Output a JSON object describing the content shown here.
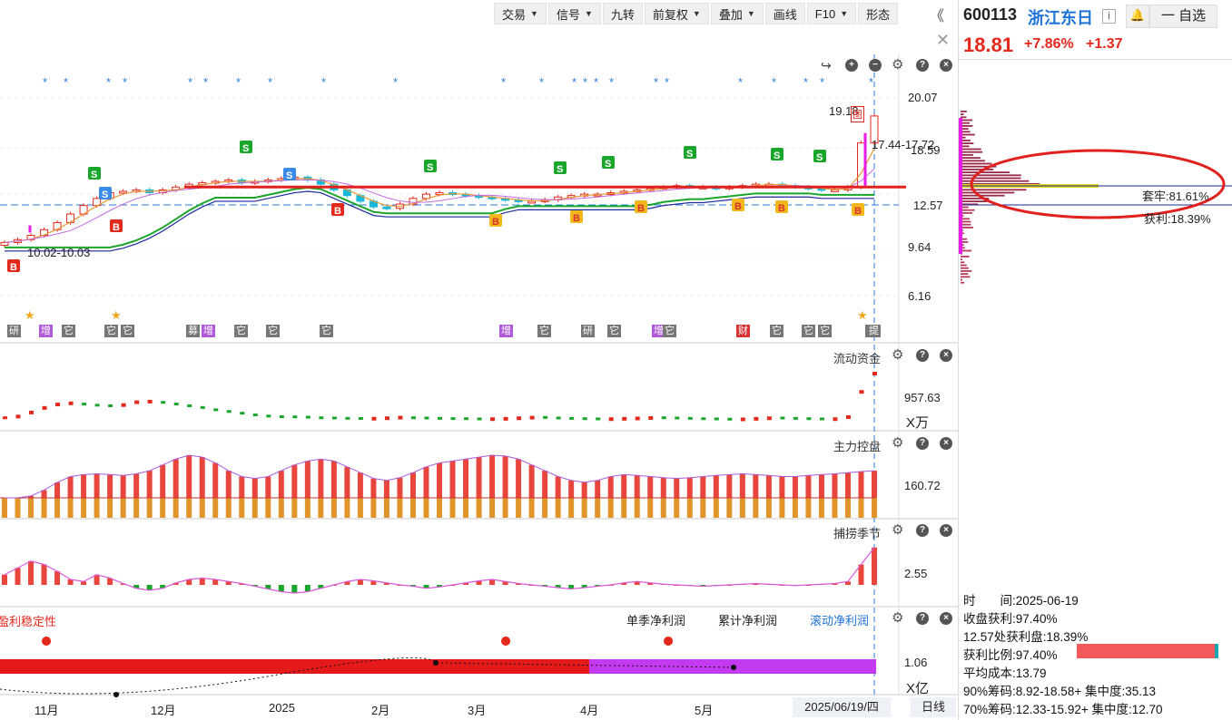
{
  "toolbar": {
    "items": [
      "交易",
      "信号",
      "九转",
      "前复权",
      "叠加",
      "画线",
      "F10",
      "形态"
    ],
    "collapse_icon": "double-chevron-left-icon"
  },
  "quote": {
    "code": "600113",
    "name": "浙江东日",
    "info_icon": "i",
    "watch_label": "一 自选",
    "price": "18.81",
    "change_pct": "+7.86%",
    "change": "+1.37"
  },
  "chip": {
    "trapped": "套牢:81.61%",
    "profit": "获利:18.39%"
  },
  "stats": {
    "time": "时　　间:2025-06-19",
    "close_profit": "收盘获利:97.40%",
    "price_profit": "12.57处获利盘:18.39%",
    "profit_ratio": "获利比例:97.40%",
    "avg_cost": "平均成本:13.79",
    "chip90": "90%筹码:8.92-18.58+ 集中度:35.13",
    "chip70": "70%筹码:12.33-15.92+ 集中度:12.70"
  },
  "main_chart": {
    "y_ticks": [
      "20.07",
      "18.59",
      "12.57",
      "9.64",
      "6.16"
    ],
    "high_label": "19.18",
    "high_marker": "图",
    "range_label": "17.44-17.72",
    "low_label": "10.02-10.03",
    "colors": {
      "up": "#e3281c",
      "down": "#1aa260",
      "highlight": "#e0211d"
    }
  },
  "panels": {
    "flow": {
      "label": "流动资金",
      "value": "957.63",
      "unit": "X万"
    },
    "main_control": {
      "label": "主力控盘",
      "value": "160.72"
    },
    "catch": {
      "label": "捕捞季节",
      "value": "2.55"
    },
    "profit_stability": {
      "label": "盈利稳定性",
      "value": "1.06",
      "unit": "X亿",
      "tabs": [
        "单季净利润",
        "累计净利润",
        "滚动净利润"
      ]
    }
  },
  "x_axis": [
    "11月",
    "12月",
    "2025",
    "2月",
    "3月",
    "4月",
    "5月"
  ],
  "cursor_date": "2025/06/19/四",
  "period": "日线",
  "event_badges": [
    "研",
    "增",
    "它",
    "它",
    "它",
    "募",
    "增",
    "它",
    "它",
    "它",
    "增",
    "它",
    "研",
    "它",
    "增",
    "它",
    "财",
    "它",
    "它",
    "它",
    "它",
    "提"
  ],
  "chart_data": {
    "type": "candlestick",
    "ylim": [
      6.16,
      20.07
    ],
    "y_ticks": [
      20.07,
      18.59,
      12.57,
      9.64,
      6.16
    ],
    "x_categories": [
      "11月",
      "12月",
      "2025",
      "2月",
      "3月",
      "4月",
      "5月"
    ],
    "resistance_level": 13.8,
    "dashed_reference": 12.57,
    "last_price": 18.81,
    "close_series": [
      9.9,
      10.1,
      10.4,
      10.8,
      11.3,
      11.9,
      12.5,
      13.0,
      13.4,
      13.5,
      13.6,
      13.4,
      13.6,
      13.8,
      14.0,
      14.1,
      14.2,
      14.3,
      14.1,
      14.2,
      14.3,
      14.4,
      14.5,
      14.3,
      14.0,
      13.6,
      13.2,
      12.8,
      12.4,
      12.3,
      12.6,
      13.0,
      13.3,
      13.4,
      13.3,
      13.2,
      13.1,
      13.0,
      12.9,
      12.8,
      12.8,
      12.9,
      13.1,
      13.2,
      13.3,
      13.3,
      13.4,
      13.5,
      13.6,
      13.7,
      13.8,
      13.9,
      13.8,
      13.8,
      13.7,
      13.8,
      13.9,
      14.0,
      14.0,
      13.9,
      13.8,
      13.7,
      13.6,
      13.6,
      13.8,
      16.9,
      18.8
    ],
    "flow_series": [
      30,
      45,
      80,
      120,
      150,
      160,
      150,
      140,
      135,
      145,
      170,
      175,
      165,
      150,
      135,
      120,
      100,
      85,
      70,
      55,
      45,
      40,
      38,
      35,
      30,
      28,
      25,
      24,
      26,
      30,
      35,
      30,
      28,
      25,
      23,
      22,
      20,
      22,
      25,
      30,
      35,
      33,
      28,
      25,
      22,
      20,
      22,
      25,
      28,
      32,
      30,
      28,
      25,
      22,
      20,
      18,
      20,
      25,
      30,
      28,
      25,
      22,
      20,
      22,
      40,
      260,
      420
    ],
    "control_series": [
      -10,
      -5,
      5,
      20,
      40,
      55,
      60,
      62,
      60,
      58,
      62,
      70,
      85,
      100,
      110,
      105,
      90,
      70,
      55,
      50,
      55,
      70,
      85,
      95,
      100,
      95,
      80,
      65,
      50,
      45,
      52,
      65,
      80,
      90,
      95,
      100,
      105,
      110,
      108,
      100,
      85,
      70,
      55,
      45,
      40,
      45,
      55,
      60,
      58,
      55,
      52,
      50,
      52,
      55,
      58,
      60,
      62,
      60,
      58,
      55,
      55,
      58,
      60,
      62,
      65,
      68,
      70
    ],
    "catch_series": [
      15,
      25,
      35,
      30,
      20,
      8,
      5,
      15,
      10,
      2,
      -5,
      -8,
      -5,
      3,
      8,
      10,
      8,
      5,
      2,
      -2,
      -6,
      -10,
      -12,
      -10,
      -5,
      0,
      5,
      8,
      6,
      3,
      0,
      -2,
      -5,
      -3,
      0,
      3,
      6,
      8,
      5,
      2,
      0,
      -2,
      -4,
      -6,
      -4,
      -2,
      0,
      3,
      5,
      3,
      1,
      0,
      -1,
      -2,
      -1,
      0,
      1,
      2,
      1,
      0,
      -1,
      0,
      1,
      2,
      5,
      30,
      55
    ],
    "series": [
      {
        "name": "单季净利润"
      },
      {
        "name": "累计净利润"
      },
      {
        "name": "滚动净利润"
      }
    ]
  }
}
